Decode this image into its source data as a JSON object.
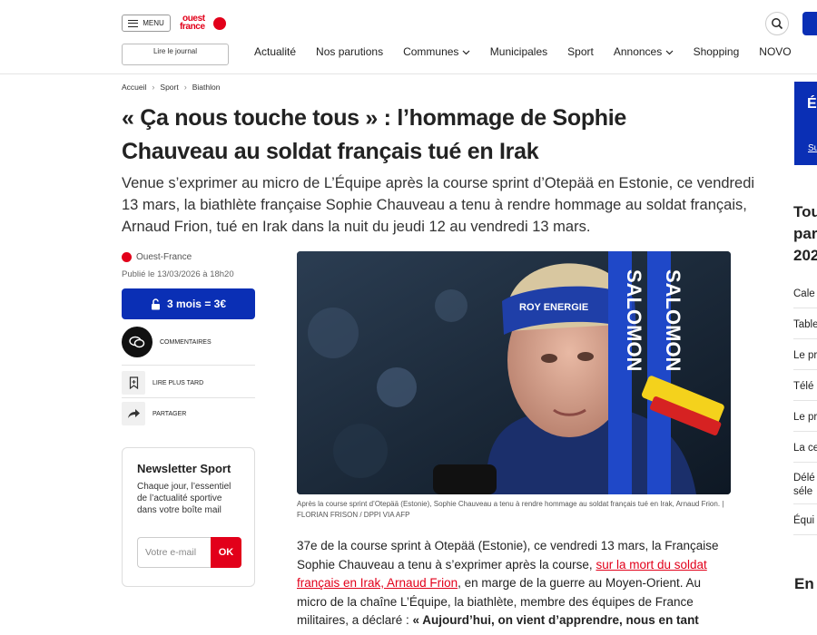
{
  "header": {
    "menu_label": "MENU",
    "logo_line1": "ouest",
    "logo_line2": "france",
    "read_journal": "Lire le journal"
  },
  "nav": {
    "items": [
      "Actualité",
      "Nos parutions",
      "Communes",
      "Municipales",
      "Sport",
      "Annonces",
      "Shopping",
      "NOVO"
    ]
  },
  "breadcrumb": [
    "Accueil",
    "Sport",
    "Biathlon"
  ],
  "article": {
    "title": "« Ça nous touche tous » : l’hommage de Sophie Chauveau au soldat français tué en Irak",
    "lead": "Venue s’exprimer au micro de L’Équipe après la course sprint d’Otepää en Estonie, ce vendredi 13 mars, la biathlète française Sophie Chauveau a tenu à rendre hommage au soldat français, Arnaud Frion, tué en Irak dans la nuit du jeudi 12 au vendredi 13 mars.",
    "source": "Ouest-France",
    "published": "Publié le 13/03/2026 à 18h20",
    "caption": "Après la course sprint d’Otepää (Estonie), Sophie Chauveau a tenu à rendre hommage au soldat français tué en Irak, Arnaud Frion. | FLORIAN FRISON / DPPI VIA AFP",
    "body_part1": "37e de la course sprint à Otepää (Estonie), ce vendredi 13 mars, la Française Sophie Chauveau a tenu à s’exprimer après la course, ",
    "body_link": "sur la mort du soldat français en Irak, Arnaud Frion",
    "body_part2": ", en marge de la guerre au Moyen-Orient. Au micro de la chaîne L’Équipe, la biathlète, membre des équipes de France militaires, a déclaré : ",
    "body_quote": "« Aujourd’hui, on vient d’apprendre, nous en tant"
  },
  "sidebar_left": {
    "subscribe_label": "3 mois = 3€",
    "comments_label": "COMMENTAIRES",
    "read_later_label": "LIRE PLUS TARD",
    "share_label": "PARTAGER",
    "newsletter_title": "Newsletter Sport",
    "newsletter_desc": "Chaque jour, l’essentiel de l’actualité sportive dans votre boîte mail",
    "newsletter_placeholder": "Votre e-mail",
    "newsletter_submit": "OK"
  },
  "photo": {
    "headband_text": "ROY ENERGIE",
    "pole_brand": "SALOMON"
  },
  "sidebar_right": {
    "banner_letter": "É",
    "banner_link": "Su",
    "title_lines": [
      "Tou",
      "par",
      "202"
    ],
    "list": [
      "Cale",
      "Table",
      "Le pr",
      "Télé",
      "Le pr",
      "La ce",
      "Délé",
      "séle",
      "Équi"
    ],
    "section_en": "En"
  },
  "colors": {
    "brand_red": "#e2001a",
    "brand_blue": "#0a2fb5"
  }
}
